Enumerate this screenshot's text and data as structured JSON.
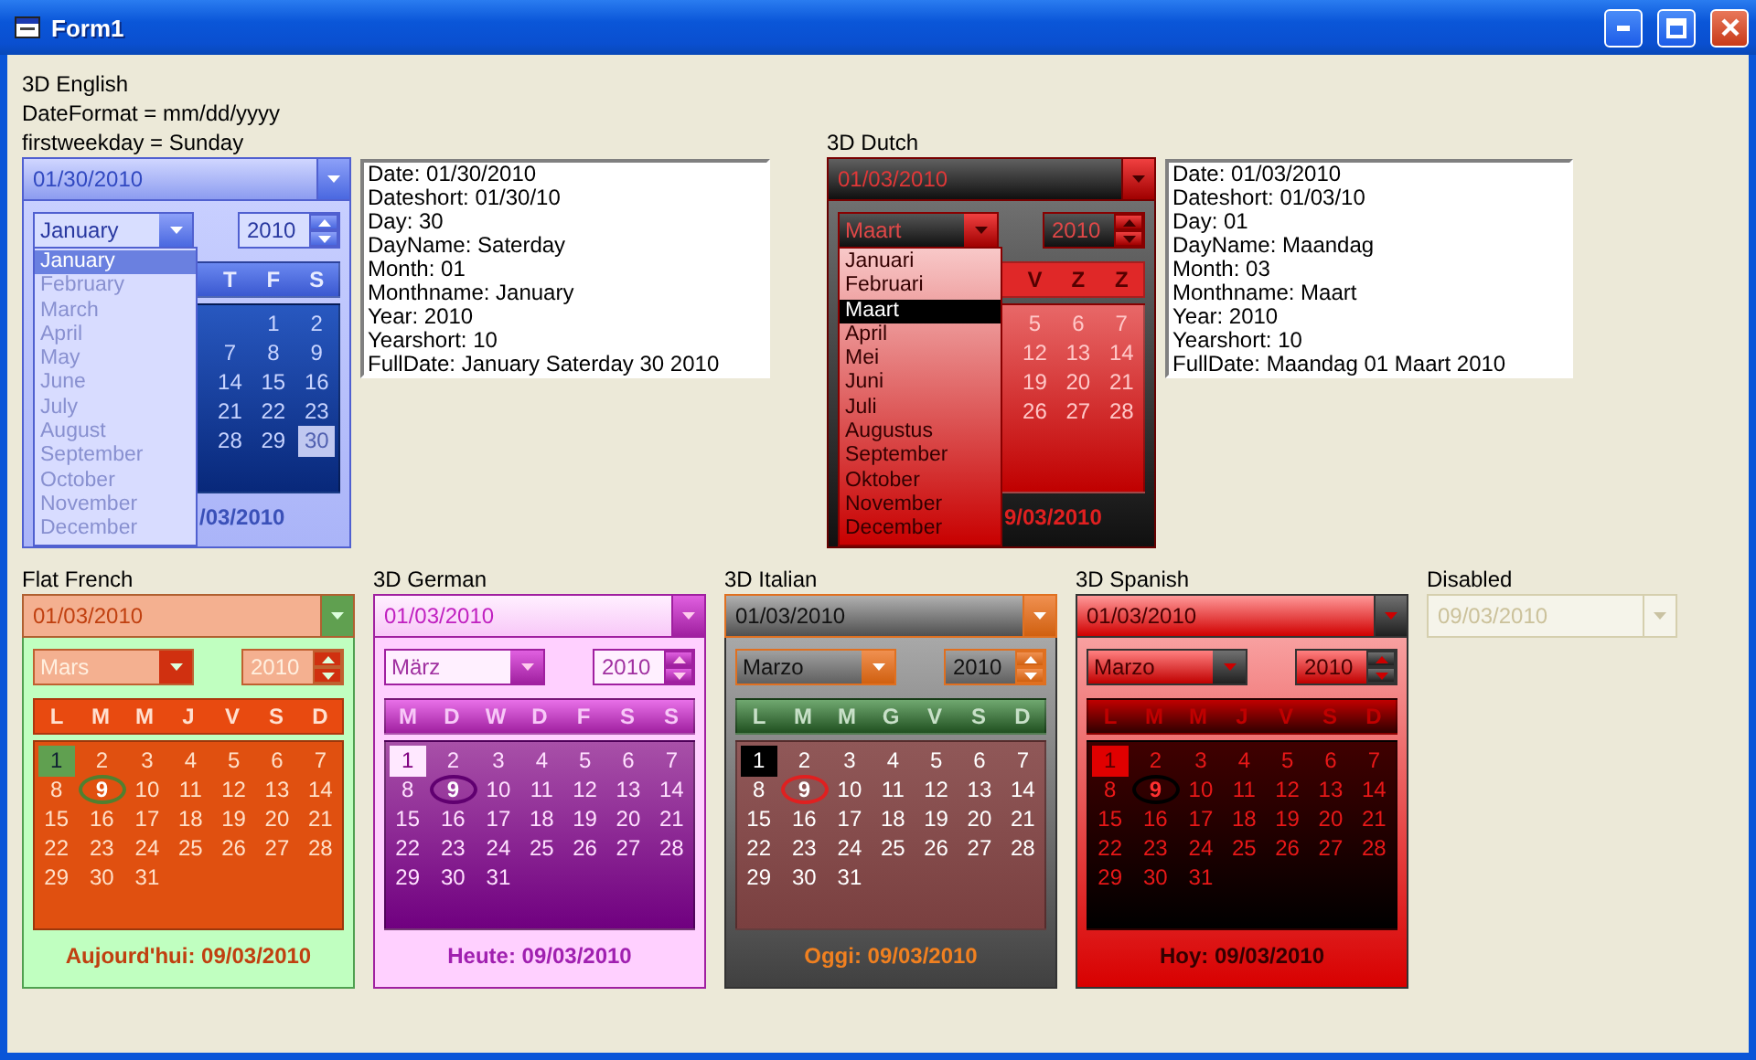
{
  "window": {
    "title": "Form1"
  },
  "top_row": [
    {
      "kind": "english",
      "caption": [
        "3D English",
        "DateFormat = mm/dd/yyyy",
        "firstweekday = Sunday"
      ],
      "value": "01/30/2010",
      "disabled": false,
      "expanded": true,
      "month": "January",
      "year": "2010",
      "month_list": [
        {
          "name": "January",
          "selected": true
        },
        {
          "name": "February",
          "selected": false
        },
        {
          "name": "March",
          "selected": false
        },
        {
          "name": "April",
          "selected": false
        },
        {
          "name": "May",
          "selected": false
        },
        {
          "name": "June",
          "selected": false
        },
        {
          "name": "July",
          "selected": false
        },
        {
          "name": "August",
          "selected": false
        },
        {
          "name": "September",
          "selected": false
        },
        {
          "name": "October",
          "selected": false
        },
        {
          "name": "November",
          "selected": false
        },
        {
          "name": "December",
          "selected": false
        }
      ],
      "weekdays": [
        "T",
        "F",
        "S"
      ],
      "weeks": [
        [
          {
            "day": "1",
            "selected": false,
            "today": false
          },
          {
            "day": "2",
            "selected": false,
            "today": false
          }
        ],
        [
          {
            "day": "7",
            "selected": false,
            "today": false
          },
          {
            "day": "8",
            "selected": false,
            "today": false
          },
          {
            "day": "9",
            "selected": false,
            "today": false
          }
        ],
        [
          {
            "day": "14",
            "selected": false,
            "today": false
          },
          {
            "day": "15",
            "selected": false,
            "today": false
          },
          {
            "day": "16",
            "selected": false,
            "today": false
          }
        ],
        [
          {
            "day": "21",
            "selected": false,
            "today": false
          },
          {
            "day": "22",
            "selected": false,
            "today": false
          },
          {
            "day": "23",
            "selected": false,
            "today": false
          }
        ],
        [
          {
            "day": "28",
            "selected": false,
            "today": false
          },
          {
            "day": "29",
            "selected": false,
            "today": false
          },
          {
            "day": "30",
            "selected": true,
            "today": false
          }
        ]
      ],
      "today_label": "/03/2010",
      "info": [
        "Date: 01/30/2010",
        "Dateshort: 01/30/10",
        "Day: 30",
        "DayName: Saterday",
        "Month: 01",
        "Monthname: January",
        "Year: 2010",
        "Yearshort: 10",
        "FullDate: January Saterday 30 2010"
      ]
    },
    {
      "kind": "dutch",
      "caption": [
        "3D Dutch"
      ],
      "value": "01/03/2010",
      "disabled": false,
      "expanded": true,
      "month": "Maart",
      "year": "2010",
      "month_list": [
        {
          "name": "Januari",
          "selected": false
        },
        {
          "name": "Februari",
          "selected": false
        },
        {
          "name": "Maart",
          "selected": true
        },
        {
          "name": "April",
          "selected": false
        },
        {
          "name": "Mei",
          "selected": false
        },
        {
          "name": "Juni",
          "selected": false
        },
        {
          "name": "Juli",
          "selected": false
        },
        {
          "name": "Augustus",
          "selected": false
        },
        {
          "name": "September",
          "selected": false
        },
        {
          "name": "Oktober",
          "selected": false
        },
        {
          "name": "November",
          "selected": false
        },
        {
          "name": "December",
          "selected": false
        }
      ],
      "weekdays": [
        "V",
        "Z",
        "Z"
      ],
      "weeks": [
        [
          {
            "day": "5",
            "selected": false,
            "today": false
          },
          {
            "day": "6",
            "selected": false,
            "today": false
          },
          {
            "day": "7",
            "selected": false,
            "today": false
          }
        ],
        [
          {
            "day": "12",
            "selected": false,
            "today": false
          },
          {
            "day": "13",
            "selected": false,
            "today": false
          },
          {
            "day": "14",
            "selected": false,
            "today": false
          }
        ],
        [
          {
            "day": "19",
            "selected": false,
            "today": false
          },
          {
            "day": "20",
            "selected": false,
            "today": false
          },
          {
            "day": "21",
            "selected": false,
            "today": false
          }
        ],
        [
          {
            "day": "26",
            "selected": false,
            "today": false
          },
          {
            "day": "27",
            "selected": false,
            "today": false
          },
          {
            "day": "28",
            "selected": false,
            "today": false
          }
        ]
      ],
      "today_label": "9/03/2010",
      "info": [
        "Date: 01/03/2010",
        "Dateshort: 01/03/10",
        "Day: 01",
        "DayName: Maandag",
        "Month: 03",
        "Monthname: Maart",
        "Year: 2010",
        "Yearshort: 10",
        "FullDate: Maandag 01 Maart 2010"
      ]
    }
  ],
  "bottom_row": [
    {
      "kind": "french",
      "caption": [
        "Flat French"
      ],
      "value": "01/03/2010",
      "disabled": false,
      "expanded": true,
      "month": "Mars",
      "year": "2010",
      "weekdays": [
        "L",
        "M",
        "M",
        "J",
        "V",
        "S",
        "D"
      ],
      "weeks": [
        [
          {
            "day": "1",
            "selected": true,
            "today": false
          },
          {
            "day": "2",
            "selected": false,
            "today": false
          },
          {
            "day": "3",
            "selected": false,
            "today": false
          },
          {
            "day": "4",
            "selected": false,
            "today": false
          },
          {
            "day": "5",
            "selected": false,
            "today": false
          },
          {
            "day": "6",
            "selected": false,
            "today": false
          },
          {
            "day": "7",
            "selected": false,
            "today": false
          }
        ],
        [
          {
            "day": "8",
            "selected": false,
            "today": false
          },
          {
            "day": "9",
            "selected": false,
            "today": true
          },
          {
            "day": "10",
            "selected": false,
            "today": false
          },
          {
            "day": "11",
            "selected": false,
            "today": false
          },
          {
            "day": "12",
            "selected": false,
            "today": false
          },
          {
            "day": "13",
            "selected": false,
            "today": false
          },
          {
            "day": "14",
            "selected": false,
            "today": false
          }
        ],
        [
          {
            "day": "15",
            "selected": false,
            "today": false
          },
          {
            "day": "16",
            "selected": false,
            "today": false
          },
          {
            "day": "17",
            "selected": false,
            "today": false
          },
          {
            "day": "18",
            "selected": false,
            "today": false
          },
          {
            "day": "19",
            "selected": false,
            "today": false
          },
          {
            "day": "20",
            "selected": false,
            "today": false
          },
          {
            "day": "21",
            "selected": false,
            "today": false
          }
        ],
        [
          {
            "day": "22",
            "selected": false,
            "today": false
          },
          {
            "day": "23",
            "selected": false,
            "today": false
          },
          {
            "day": "24",
            "selected": false,
            "today": false
          },
          {
            "day": "25",
            "selected": false,
            "today": false
          },
          {
            "day": "26",
            "selected": false,
            "today": false
          },
          {
            "day": "27",
            "selected": false,
            "today": false
          },
          {
            "day": "28",
            "selected": false,
            "today": false
          }
        ],
        [
          {
            "day": "29",
            "selected": false,
            "today": false
          },
          {
            "day": "30",
            "selected": false,
            "today": false
          },
          {
            "day": "31",
            "selected": false,
            "today": false
          }
        ]
      ],
      "today_label": "Aujourd'hui: 09/03/2010"
    },
    {
      "kind": "german",
      "caption": [
        "3D German"
      ],
      "value": "01/03/2010",
      "disabled": false,
      "expanded": true,
      "month": "März",
      "year": "2010",
      "weekdays": [
        "M",
        "D",
        "W",
        "D",
        "F",
        "S",
        "S"
      ],
      "weeks": [
        [
          {
            "day": "1",
            "selected": true,
            "today": false
          },
          {
            "day": "2",
            "selected": false,
            "today": false
          },
          {
            "day": "3",
            "selected": false,
            "today": false
          },
          {
            "day": "4",
            "selected": false,
            "today": false
          },
          {
            "day": "5",
            "selected": false,
            "today": false
          },
          {
            "day": "6",
            "selected": false,
            "today": false
          },
          {
            "day": "7",
            "selected": false,
            "today": false
          }
        ],
        [
          {
            "day": "8",
            "selected": false,
            "today": false
          },
          {
            "day": "9",
            "selected": false,
            "today": true
          },
          {
            "day": "10",
            "selected": false,
            "today": false
          },
          {
            "day": "11",
            "selected": false,
            "today": false
          },
          {
            "day": "12",
            "selected": false,
            "today": false
          },
          {
            "day": "13",
            "selected": false,
            "today": false
          },
          {
            "day": "14",
            "selected": false,
            "today": false
          }
        ],
        [
          {
            "day": "15",
            "selected": false,
            "today": false
          },
          {
            "day": "16",
            "selected": false,
            "today": false
          },
          {
            "day": "17",
            "selected": false,
            "today": false
          },
          {
            "day": "18",
            "selected": false,
            "today": false
          },
          {
            "day": "19",
            "selected": false,
            "today": false
          },
          {
            "day": "20",
            "selected": false,
            "today": false
          },
          {
            "day": "21",
            "selected": false,
            "today": false
          }
        ],
        [
          {
            "day": "22",
            "selected": false,
            "today": false
          },
          {
            "day": "23",
            "selected": false,
            "today": false
          },
          {
            "day": "24",
            "selected": false,
            "today": false
          },
          {
            "day": "25",
            "selected": false,
            "today": false
          },
          {
            "day": "26",
            "selected": false,
            "today": false
          },
          {
            "day": "27",
            "selected": false,
            "today": false
          },
          {
            "day": "28",
            "selected": false,
            "today": false
          }
        ],
        [
          {
            "day": "29",
            "selected": false,
            "today": false
          },
          {
            "day": "30",
            "selected": false,
            "today": false
          },
          {
            "day": "31",
            "selected": false,
            "today": false
          }
        ]
      ],
      "today_label": "Heute: 09/03/2010"
    },
    {
      "kind": "italian",
      "caption": [
        "3D Italian"
      ],
      "value": "01/03/2010",
      "disabled": false,
      "expanded": true,
      "month": "Marzo",
      "year": "2010",
      "weekdays": [
        "L",
        "M",
        "M",
        "G",
        "V",
        "S",
        "D"
      ],
      "weeks": [
        [
          {
            "day": "1",
            "selected": true,
            "today": false
          },
          {
            "day": "2",
            "selected": false,
            "today": false
          },
          {
            "day": "3",
            "selected": false,
            "today": false
          },
          {
            "day": "4",
            "selected": false,
            "today": false
          },
          {
            "day": "5",
            "selected": false,
            "today": false
          },
          {
            "day": "6",
            "selected": false,
            "today": false
          },
          {
            "day": "7",
            "selected": false,
            "today": false
          }
        ],
        [
          {
            "day": "8",
            "selected": false,
            "today": false
          },
          {
            "day": "9",
            "selected": false,
            "today": true
          },
          {
            "day": "10",
            "selected": false,
            "today": false
          },
          {
            "day": "11",
            "selected": false,
            "today": false
          },
          {
            "day": "12",
            "selected": false,
            "today": false
          },
          {
            "day": "13",
            "selected": false,
            "today": false
          },
          {
            "day": "14",
            "selected": false,
            "today": false
          }
        ],
        [
          {
            "day": "15",
            "selected": false,
            "today": false
          },
          {
            "day": "16",
            "selected": false,
            "today": false
          },
          {
            "day": "17",
            "selected": false,
            "today": false
          },
          {
            "day": "18",
            "selected": false,
            "today": false
          },
          {
            "day": "19",
            "selected": false,
            "today": false
          },
          {
            "day": "20",
            "selected": false,
            "today": false
          },
          {
            "day": "21",
            "selected": false,
            "today": false
          }
        ],
        [
          {
            "day": "22",
            "selected": false,
            "today": false
          },
          {
            "day": "23",
            "selected": false,
            "today": false
          },
          {
            "day": "24",
            "selected": false,
            "today": false
          },
          {
            "day": "25",
            "selected": false,
            "today": false
          },
          {
            "day": "26",
            "selected": false,
            "today": false
          },
          {
            "day": "27",
            "selected": false,
            "today": false
          },
          {
            "day": "28",
            "selected": false,
            "today": false
          }
        ],
        [
          {
            "day": "29",
            "selected": false,
            "today": false
          },
          {
            "day": "30",
            "selected": false,
            "today": false
          },
          {
            "day": "31",
            "selected": false,
            "today": false
          }
        ]
      ],
      "today_label": "Oggi: 09/03/2010"
    },
    {
      "kind": "spanish",
      "caption": [
        "3D Spanish"
      ],
      "value": "01/03/2010",
      "disabled": false,
      "expanded": true,
      "month": "Marzo",
      "year": "2010",
      "weekdays": [
        "L",
        "M",
        "M",
        "J",
        "V",
        "S",
        "D"
      ],
      "weeks": [
        [
          {
            "day": "1",
            "selected": true,
            "today": false
          },
          {
            "day": "2",
            "selected": false,
            "today": false
          },
          {
            "day": "3",
            "selected": false,
            "today": false
          },
          {
            "day": "4",
            "selected": false,
            "today": false
          },
          {
            "day": "5",
            "selected": false,
            "today": false
          },
          {
            "day": "6",
            "selected": false,
            "today": false
          },
          {
            "day": "7",
            "selected": false,
            "today": false
          }
        ],
        [
          {
            "day": "8",
            "selected": false,
            "today": false
          },
          {
            "day": "9",
            "selected": false,
            "today": true
          },
          {
            "day": "10",
            "selected": false,
            "today": false
          },
          {
            "day": "11",
            "selected": false,
            "today": false
          },
          {
            "day": "12",
            "selected": false,
            "today": false
          },
          {
            "day": "13",
            "selected": false,
            "today": false
          },
          {
            "day": "14",
            "selected": false,
            "today": false
          }
        ],
        [
          {
            "day": "15",
            "selected": false,
            "today": false
          },
          {
            "day": "16",
            "selected": false,
            "today": false
          },
          {
            "day": "17",
            "selected": false,
            "today": false
          },
          {
            "day": "18",
            "selected": false,
            "today": false
          },
          {
            "day": "19",
            "selected": false,
            "today": false
          },
          {
            "day": "20",
            "selected": false,
            "today": false
          },
          {
            "day": "21",
            "selected": false,
            "today": false
          }
        ],
        [
          {
            "day": "22",
            "selected": false,
            "today": false
          },
          {
            "day": "23",
            "selected": false,
            "today": false
          },
          {
            "day": "24",
            "selected": false,
            "today": false
          },
          {
            "day": "25",
            "selected": false,
            "today": false
          },
          {
            "day": "26",
            "selected": false,
            "today": false
          },
          {
            "day": "27",
            "selected": false,
            "today": false
          },
          {
            "day": "28",
            "selected": false,
            "today": false
          }
        ],
        [
          {
            "day": "29",
            "selected": false,
            "today": false
          },
          {
            "day": "30",
            "selected": false,
            "today": false
          },
          {
            "day": "31",
            "selected": false,
            "today": false
          }
        ]
      ],
      "today_label": "Hoy: 09/03/2010"
    },
    {
      "kind": "plain",
      "caption": [
        "Disabled"
      ],
      "value": "09/03/2010",
      "disabled": true,
      "expanded": false
    }
  ]
}
